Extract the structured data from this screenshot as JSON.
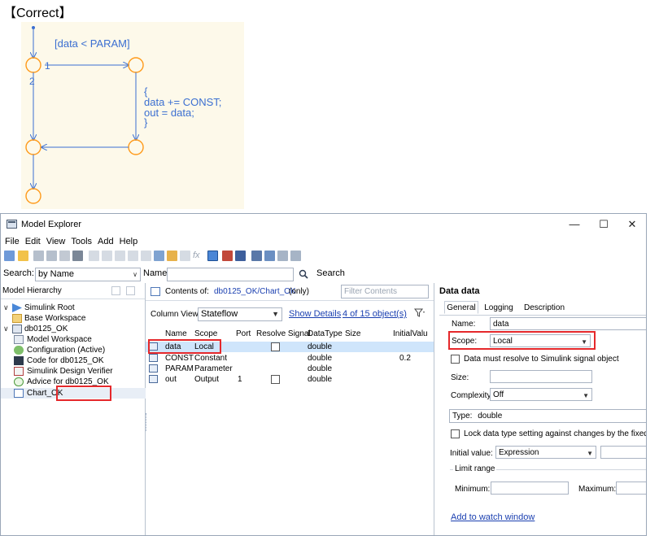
{
  "heading": "【Correct】",
  "chart": {
    "guard": "[data < PARAM]",
    "order_1": "1",
    "order_2": "2",
    "action_lines": [
      "{",
      "data += CONST;",
      "out = data;",
      "}"
    ]
  },
  "window": {
    "title": "Model Explorer",
    "controls": {
      "minimize": "—",
      "maximize": "☐",
      "close": "✕"
    },
    "menu": [
      "File",
      "Edit",
      "View",
      "Tools",
      "Add",
      "Help"
    ],
    "search": {
      "label": "Search:",
      "mode": "by Name",
      "name_label": "Name:",
      "name_value": "",
      "button": "Search"
    },
    "hierarchy": {
      "header": "Model Hierarchy",
      "items": [
        {
          "label": "Simulink Root",
          "icon": "simulink-root-icon"
        },
        {
          "label": "Base Workspace",
          "icon": "workspace-icon"
        },
        {
          "label": "db0125_OK",
          "icon": "model-icon"
        },
        {
          "label": "Model Workspace",
          "icon": "model-workspace-icon"
        },
        {
          "label": "Configuration (Active)",
          "icon": "configuration-icon"
        },
        {
          "label": "Code for db0125_OK",
          "icon": "code-icon"
        },
        {
          "label": "Simulink Design Verifier",
          "icon": "sldv-icon"
        },
        {
          "label": "Advice for db0125_OK",
          "icon": "advice-icon"
        },
        {
          "label": "Chart_OK",
          "icon": "chart-icon"
        }
      ]
    },
    "contents": {
      "label": "Contents of:",
      "path": "db0125_OK/Chart_OK",
      "suffix": "(only)",
      "filter_placeholder": "Filter Contents",
      "column_view_label": "Column View:",
      "column_view": "Stateflow",
      "show_details": "Show Details",
      "object_count": "4 of 15 object(s)",
      "columns": [
        "Name",
        "Scope",
        "Port",
        "Resolve Signal",
        "DataType",
        "Size",
        "InitialValu"
      ],
      "rows": [
        {
          "name": "data",
          "scope": "Local",
          "port": "",
          "resolve": true,
          "datatype": "double",
          "size": "",
          "initial": ""
        },
        {
          "name": "CONST",
          "scope": "Constant",
          "port": "",
          "resolve": false,
          "datatype": "double",
          "size": "",
          "initial": "0.2"
        },
        {
          "name": "PARAM",
          "scope": "Parameter",
          "port": "",
          "resolve": false,
          "datatype": "double",
          "size": "",
          "initial": ""
        },
        {
          "name": "out",
          "scope": "Output",
          "port": "1",
          "resolve": true,
          "datatype": "double",
          "size": "",
          "initial": ""
        }
      ]
    },
    "properties": {
      "title": "Data data",
      "tabs": [
        "General",
        "Logging",
        "Description"
      ],
      "active_tab": "General",
      "name_label": "Name:",
      "name_value": "data",
      "scope_label": "Scope:",
      "scope_value": "Local",
      "resolve_label": "Data must resolve to Simulink signal object",
      "size_label": "Size:",
      "size_value": "",
      "complexity_label": "Complexity:",
      "complexity_value": "Off",
      "type_label": "Type:",
      "type_value": "double",
      "lock_label": "Lock data type setting against changes by the fixed-point",
      "initial_label": "Initial value:",
      "initial_value": "Expression",
      "limit_label": "Limit range",
      "min_label": "Minimum:",
      "max_label": "Maximum:",
      "watch_link": "Add to watch window"
    },
    "colors": {
      "highlight": "#e5282b",
      "selection": "#cfe5fb",
      "link": "#1a3fb0",
      "chart_stroke": "#3b6fd1",
      "chart_fill": "#fdf9ea"
    }
  }
}
